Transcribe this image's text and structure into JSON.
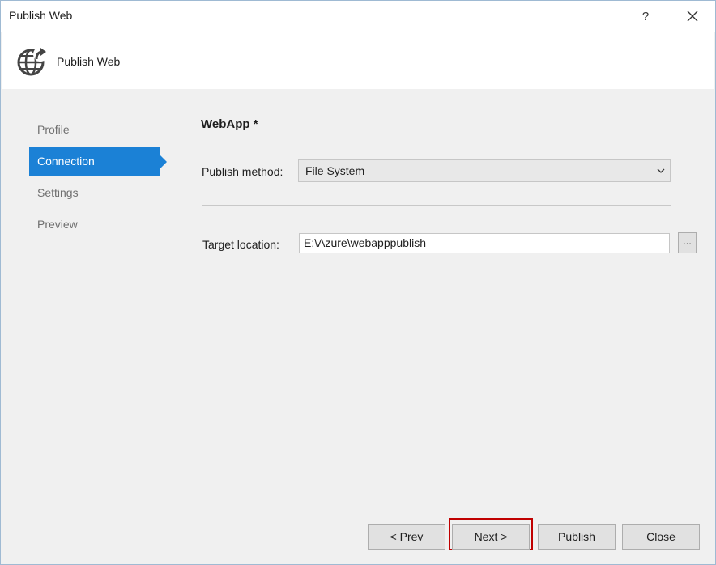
{
  "window": {
    "title": "Publish Web",
    "help_label": "?"
  },
  "header": {
    "title": "Publish Web",
    "icon": "globe-publish-icon"
  },
  "nav": {
    "items": [
      {
        "label": "Profile",
        "active": false
      },
      {
        "label": "Connection",
        "active": true
      },
      {
        "label": "Settings",
        "active": false
      },
      {
        "label": "Preview",
        "active": false
      }
    ]
  },
  "content": {
    "profile_name": "WebApp *",
    "publish_method": {
      "label": "Publish method:",
      "value": "File System"
    },
    "target_location": {
      "label": "Target location:",
      "value": "E:\\Azure\\webapppublish",
      "browse_label": "..."
    }
  },
  "footer": {
    "prev_label": "< Prev",
    "next_label": "Next >",
    "publish_label": "Publish",
    "close_label": "Close"
  },
  "colors": {
    "accent": "#1b81d6",
    "highlight_border": "#c00000"
  }
}
